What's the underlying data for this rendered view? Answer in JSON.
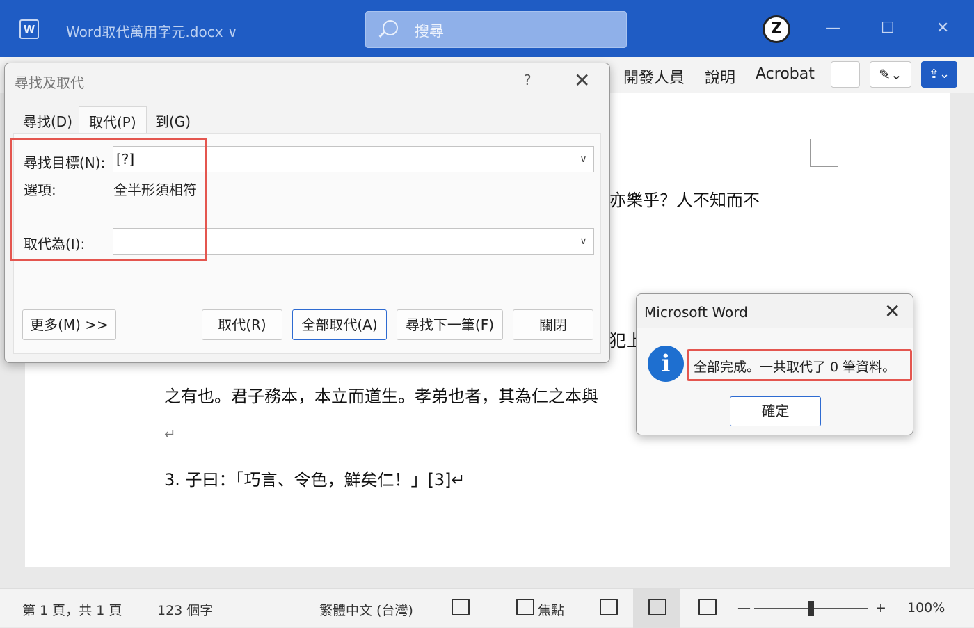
{
  "titlebar": {
    "doc_title": "Word取代萬用字元.docx ∨",
    "search_placeholder": "搜尋",
    "minimize": "—",
    "maximize": "☐",
    "close": "✕",
    "app_icon": "word-icon",
    "profile_icon": "zz-logo-icon"
  },
  "ribbon": {
    "tabs": [
      "開發人員",
      "說明",
      "Acrobat"
    ]
  },
  "document": {
    "line1_fragment": "亦樂乎？人不知而不",
    "line2_fragment": "犯上",
    "line3": "之有也。君子務本，本立而道生。孝弟也者，其為仁之本與",
    "para_mark": "↵",
    "line4": "3.  子曰：「巧言、令色，鮮矣仁！」[3]↵"
  },
  "find_replace": {
    "title": "尋找及取代",
    "help": "?",
    "close": "✕",
    "tabs": [
      "尋找(D)",
      "取代(P)",
      "到(G)"
    ],
    "find_label": "尋找目標(N):",
    "find_value": "[?]",
    "options_label": "選項:",
    "options_value": "全半形須相符",
    "replace_label": "取代為(I):",
    "replace_value": "",
    "buttons": {
      "more": "更多(M) >>",
      "replace": "取代(R)",
      "replace_all": "全部取代(A)",
      "find_next": "尋找下一筆(F)",
      "close": "關閉"
    }
  },
  "message_box": {
    "title": "Microsoft Word",
    "close": "✕",
    "icon": "info-icon",
    "text": "全部完成。一共取代了 0 筆資料。",
    "ok": "確定"
  },
  "statusbar": {
    "page": "第 1 頁，共 1 頁",
    "words": "123 個字",
    "language": "繁體中文 (台灣)",
    "focus": "焦點",
    "zoom_minus": "—",
    "zoom_plus": "+",
    "zoom": "100%"
  },
  "colors": {
    "titlebar": "#1f5cc4",
    "highlight": "#e4564f",
    "info": "#1e6fd0"
  }
}
